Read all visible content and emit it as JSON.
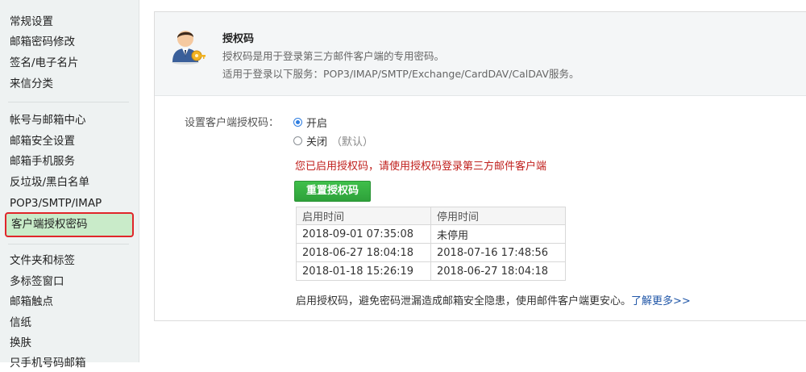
{
  "sidebar": {
    "group1": [
      "常规设置",
      "邮箱密码修改",
      "签名/电子名片",
      "来信分类"
    ],
    "group2": [
      "帐号与邮箱中心",
      "邮箱安全设置",
      "邮箱手机服务",
      "反垃圾/黑白名单",
      "POP3/SMTP/IMAP"
    ],
    "active": "客户端授权密码",
    "group3": [
      "文件夹和标签",
      "多标签窗口",
      "邮箱触点",
      "信纸",
      "换肤",
      "只手机号码邮箱"
    ]
  },
  "header": {
    "title": "授权码",
    "desc1": "授权码是用于登录第三方邮件客户端的专用密码。",
    "desc2": "适用于登录以下服务：POP3/IMAP/SMTP/Exchange/CardDAV/CalDAV服务。"
  },
  "setting": {
    "label": "设置客户端授权码：",
    "option_on": "开启",
    "option_off": "关闭",
    "option_off_hint": "（默认）",
    "selected": "开启"
  },
  "notice": "您已启用授权码，请使用授权码登录第三方邮件客户端",
  "reset_button": "重置授权码",
  "table": {
    "headers": [
      "启用时间",
      "停用时间"
    ],
    "rows": [
      [
        "2018-09-01 07:35:08",
        "未停用"
      ],
      [
        "2018-06-27 18:04:18",
        "2018-07-16 17:48:56"
      ],
      [
        "2018-01-18 15:26:19",
        "2018-06-27 18:04:18"
      ]
    ]
  },
  "footer": {
    "text": "启用授权码，避免密码泄漏造成邮箱安全隐患，使用邮件客户端更安心。",
    "link": "了解更多>>"
  },
  "colors": {
    "accent_green": "#2ea13a",
    "notice_red": "#c0201d",
    "link_blue": "#2157a8",
    "highlight_border": "#e0262a"
  }
}
